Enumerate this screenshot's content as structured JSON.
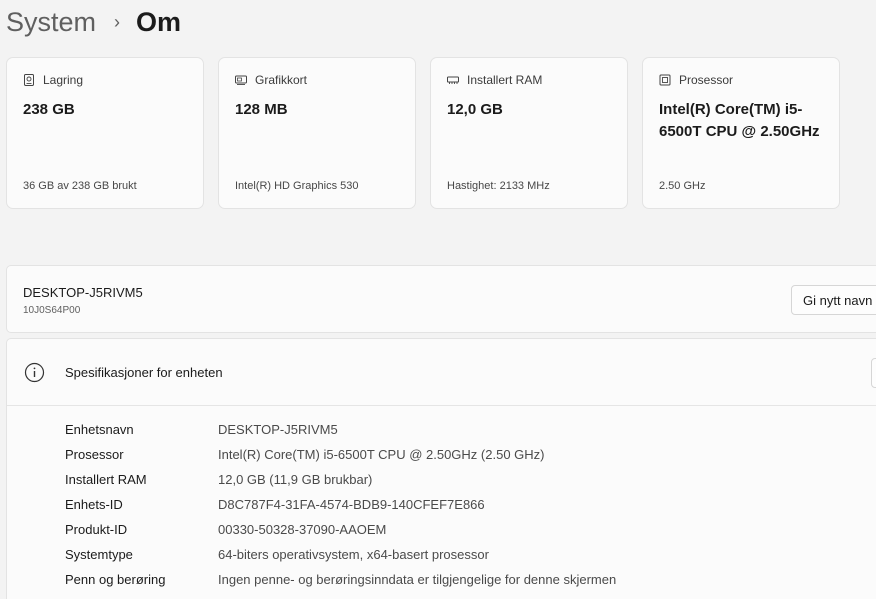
{
  "breadcrumb": {
    "root": "System",
    "separator": "›",
    "current": "Om"
  },
  "cards": [
    {
      "icon": "storage-icon",
      "label": "Lagring",
      "value": "238 GB",
      "sub": "36 GB av 238 GB brukt"
    },
    {
      "icon": "graphics-card-icon",
      "label": "Grafikkort",
      "value": "128 MB",
      "sub": "Intel(R) HD Graphics 530"
    },
    {
      "icon": "ram-icon",
      "label": "Installert RAM",
      "value": "12,0 GB",
      "sub": "Hastighet: 2133 MHz"
    },
    {
      "icon": "processor-icon",
      "label": "Prosessor",
      "value": "Intel(R) Core(TM) i5-6500T CPU @ 2.50GHz",
      "sub": "2.50 GHz"
    }
  ],
  "device": {
    "name": "DESKTOP-J5RIVM5",
    "model": "10J0S64P00",
    "rename_label": "Gi nytt navn"
  },
  "specs": {
    "title": "Spesifikasjoner for enheten",
    "rows": [
      {
        "label": "Enhetsnavn",
        "value": "DESKTOP-J5RIVM5"
      },
      {
        "label": "Prosessor",
        "value": "Intel(R) Core(TM) i5-6500T CPU @ 2.50GHz (2.50 GHz)"
      },
      {
        "label": "Installert RAM",
        "value": "12,0 GB (11,9 GB brukbar)"
      },
      {
        "label": "Enhets-ID",
        "value": "D8C787F4-31FA-4574-BDB9-140CFEF7E866"
      },
      {
        "label": "Produkt-ID",
        "value": "00330-50328-37090-AAOEM"
      },
      {
        "label": "Systemtype",
        "value": "64-biters operativsystem, x64-basert prosessor"
      },
      {
        "label": "Penn og berøring",
        "value": "Ingen penne- og berøringsinndata er tilgjengelige for denne skjermen"
      }
    ]
  }
}
